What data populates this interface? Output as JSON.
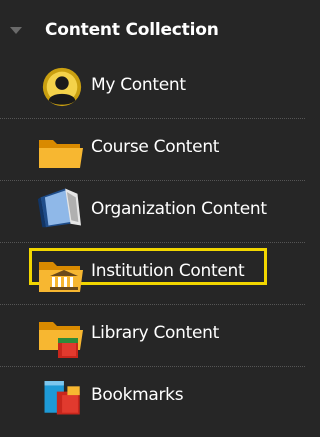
{
  "panel": {
    "title": "Content Collection",
    "items": [
      {
        "label": "My Content",
        "icon": "user-avatar-icon"
      },
      {
        "label": "Course Content",
        "icon": "folder-icon"
      },
      {
        "label": "Organization Content",
        "icon": "organization-book-icon"
      },
      {
        "label": "Institution Content",
        "icon": "institution-folder-icon",
        "highlighted": true
      },
      {
        "label": "Library Content",
        "icon": "library-folder-icon"
      },
      {
        "label": "Bookmarks",
        "icon": "bookmarks-icon"
      }
    ]
  },
  "colors": {
    "background": "#262626",
    "highlight": "#f2d600",
    "text": "#ffffff"
  }
}
